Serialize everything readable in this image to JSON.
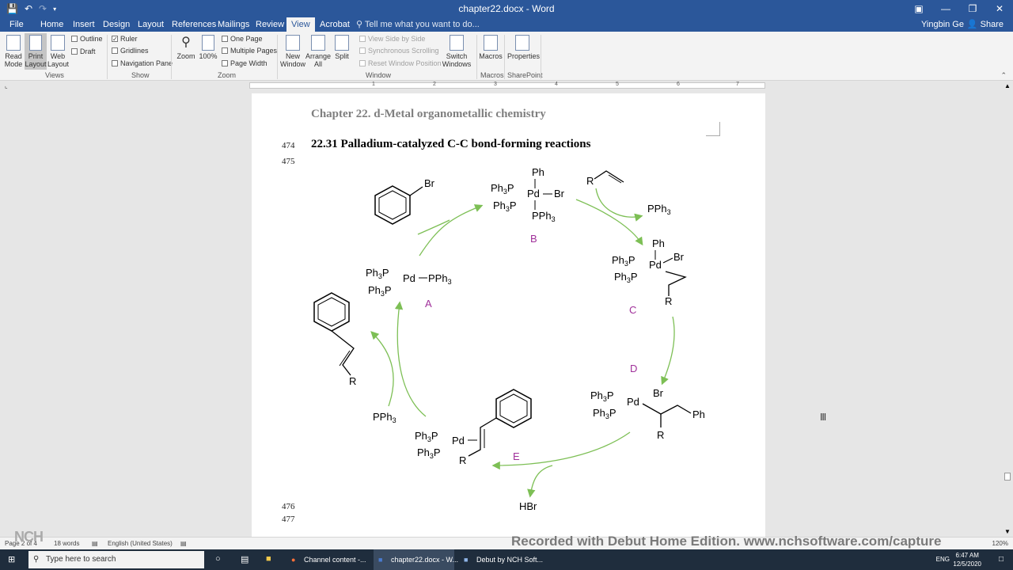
{
  "titlebar": {
    "doc_title": "chapter22.docx - Word",
    "qat": [
      "save-icon",
      "undo-icon",
      "redo-icon",
      "customize-icon"
    ],
    "controls": [
      "ribbon-display-icon",
      "minimize-icon",
      "restore-icon",
      "close-icon"
    ]
  },
  "tabs": [
    "File",
    "Home",
    "Insert",
    "Design",
    "Layout",
    "References",
    "Mailings",
    "Review",
    "View",
    "Acrobat"
  ],
  "active_tab": "View",
  "tell_me": "Tell me what you want to do...",
  "user": "Yingbin Ge",
  "share": "Share",
  "ribbon": {
    "views": {
      "read_mode": "Read Mode",
      "print_layout": "Print Layout",
      "web_layout": "Web Layout",
      "outline": "Outline",
      "draft": "Draft",
      "label": "Views"
    },
    "show": {
      "ruler": "Ruler",
      "gridlines": "Gridlines",
      "nav_pane": "Navigation Pane",
      "label": "Show"
    },
    "zoom": {
      "zoom": "Zoom",
      "hundred": "100%",
      "one_page": "One Page",
      "multiple_pages": "Multiple Pages",
      "page_width": "Page Width",
      "label": "Zoom"
    },
    "window": {
      "new_window": "New Window",
      "arrange_all": "Arrange All",
      "split": "Split",
      "side_by_side": "View Side by Side",
      "sync_scroll": "Synchronous Scrolling",
      "reset_pos": "Reset Window Position",
      "switch": "Switch Windows",
      "label": "Window"
    },
    "macros": {
      "macros": "Macros",
      "label": "Macros"
    },
    "sharepoint": {
      "properties": "Properties",
      "label": "SharePoint"
    }
  },
  "ruler_numbers": [
    "1",
    "2",
    "3",
    "4",
    "5",
    "6",
    "7"
  ],
  "document": {
    "chapter": "Chapter 22. d-Metal organometallic chemistry",
    "section": "22.31 Palladium-catalyzed C-C bond-forming reactions",
    "line_numbers": {
      "l474": "474",
      "l475": "475",
      "l476": "476",
      "l477": "477"
    }
  },
  "figure": {
    "labels": {
      "A": "A",
      "B": "B",
      "C": "C",
      "D": "D",
      "E": "E"
    },
    "label_color": "#a0309a",
    "arrow_color": "#7dbf55",
    "text": {
      "br": "Br",
      "ph": "Ph",
      "pd": "Pd",
      "r": "R",
      "hbr": "HBr",
      "pph3": "PPh",
      "ph3p": "Ph",
      "sub3": "3",
      "p": "P",
      "dash": "—"
    }
  },
  "status": {
    "page": "Page 2 of 4",
    "words": "18 words",
    "language": "English (United States)",
    "zoom": "120%"
  },
  "watermark": "Recorded with Debut Home Edition. www.nchsoftware.com/capture",
  "nch_logo": "NCH",
  "taskbar": {
    "search": "Type here to search",
    "apps": [
      "Channel content -...",
      "chapter22.docx - W...",
      "Debut by NCH Soft..."
    ],
    "lang": "ENG",
    "time": "6:47 AM",
    "date": "12/5/2020"
  }
}
